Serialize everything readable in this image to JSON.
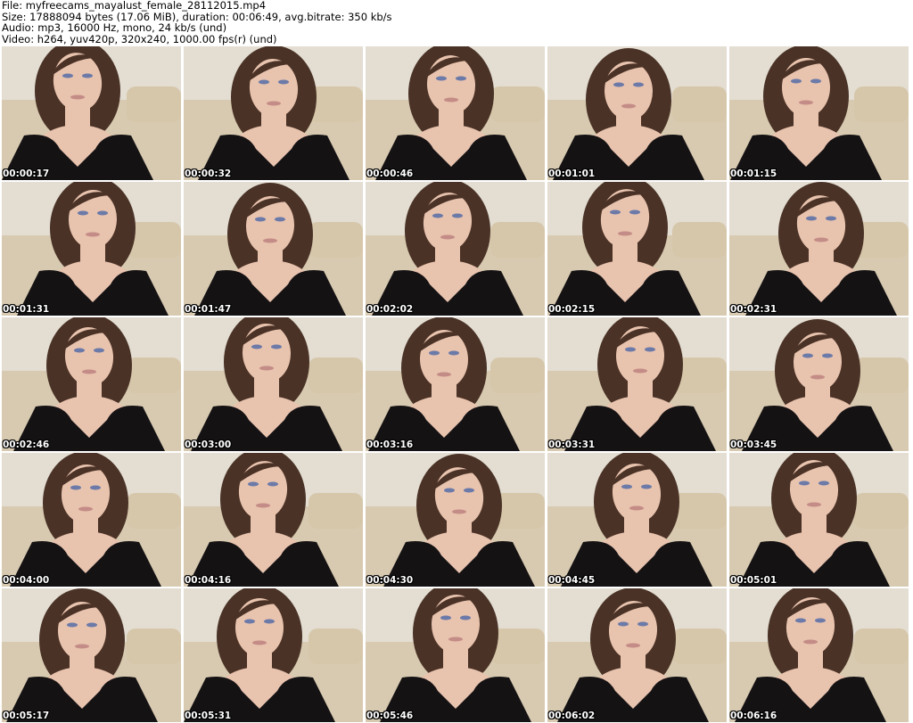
{
  "header": {
    "file": "File: myfreecams_mayalust_female_28112015.mp4",
    "size": "Size: 17888094 bytes (17.06 MiB), duration: 00:06:49, avg.bitrate: 350 kb/s",
    "audio": "Audio: mp3, 16000 Hz, mono, 24 kb/s (und)",
    "video": "Video: h264, yuv420p, 320x240, 1000.00 fps(r) (und)"
  },
  "thumbnails": [
    {
      "timestamp": "00:00:17"
    },
    {
      "timestamp": "00:00:32"
    },
    {
      "timestamp": "00:00:46"
    },
    {
      "timestamp": "00:01:01"
    },
    {
      "timestamp": "00:01:15"
    },
    {
      "timestamp": "00:01:31"
    },
    {
      "timestamp": "00:01:47"
    },
    {
      "timestamp": "00:02:02"
    },
    {
      "timestamp": "00:02:15"
    },
    {
      "timestamp": "00:02:31"
    },
    {
      "timestamp": "00:02:46"
    },
    {
      "timestamp": "00:03:00"
    },
    {
      "timestamp": "00:03:16"
    },
    {
      "timestamp": "00:03:31"
    },
    {
      "timestamp": "00:03:45"
    },
    {
      "timestamp": "00:04:00"
    },
    {
      "timestamp": "00:04:16"
    },
    {
      "timestamp": "00:04:30"
    },
    {
      "timestamp": "00:04:45"
    },
    {
      "timestamp": "00:05:01"
    },
    {
      "timestamp": "00:05:17"
    },
    {
      "timestamp": "00:05:31"
    },
    {
      "timestamp": "00:05:46"
    },
    {
      "timestamp": "00:06:02"
    },
    {
      "timestamp": "00:06:16"
    }
  ],
  "colors": {
    "page_background": "#ffffff",
    "header_text": "#000000",
    "timestamp_text": "#ffffff",
    "timestamp_outline": "#000000",
    "wall": "#e3ddd2",
    "couch": "#d6c7aa",
    "hair": "#4a3226",
    "skin": "#e8c3ae",
    "top": "#151214"
  }
}
